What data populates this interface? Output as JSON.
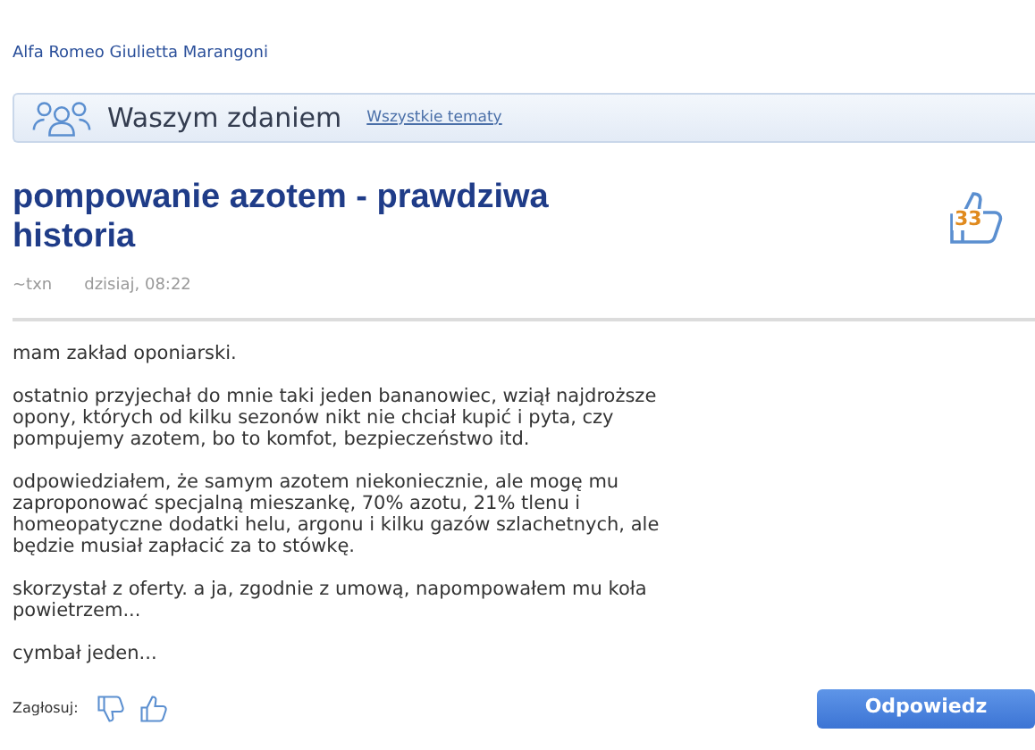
{
  "breadcrumb": "Alfa Romeo Giulietta Marangoni",
  "section": {
    "title": "Waszym zdaniem",
    "link": "Wszystkie tematy"
  },
  "post": {
    "title": "pompowanie azotem - prawdziwa historia",
    "likes": "33",
    "author": "~txn",
    "time": "dzisiaj, 08:22",
    "paragraphs": [
      "mam zakład oponiarski.",
      "ostatnio przyjechał do mnie taki jeden bananowiec, wziął najdroższe opony, których od kilku sezonów nikt nie chciał kupić i pyta, czy pompujemy azotem, bo to komfot, bezpieczeństwo itd.",
      "odpowiedziałem, że samym azotem niekoniecznie, ale mogę mu zaproponować specjalną mieszankę, 70% azotu, 21% tlenu i homeopatyczne dodatki helu, argonu i kilku gazów szlachetnych, ale będzie musiał zapłacić za to stówkę.",
      "skorzystał z oferty. a ja, zgodnie z umową, napompowałem mu koła powietrzem...",
      "cymbał jeden..."
    ]
  },
  "footer": {
    "vote_label": "Zagłosuj:",
    "reply_button": "Odpowiedz"
  }
}
